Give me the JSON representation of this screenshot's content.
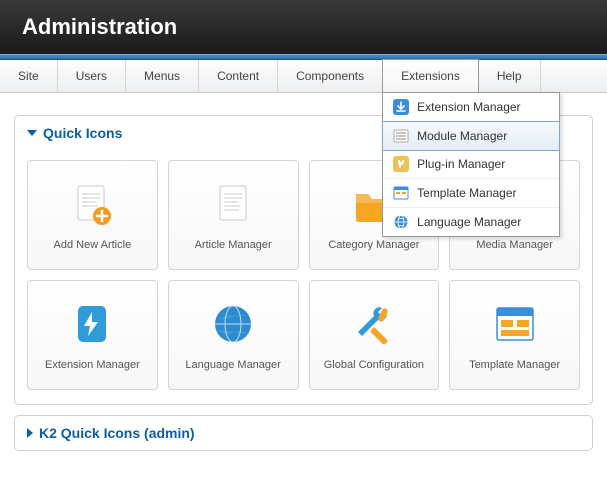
{
  "header": {
    "title": "Administration"
  },
  "menubar": {
    "items": [
      {
        "label": "Site"
      },
      {
        "label": "Users"
      },
      {
        "label": "Menus"
      },
      {
        "label": "Content"
      },
      {
        "label": "Components"
      },
      {
        "label": "Extensions",
        "open": true
      },
      {
        "label": "Help"
      }
    ]
  },
  "dropdown": {
    "items": [
      {
        "label": "Extension Manager",
        "icon": "download-icon"
      },
      {
        "label": "Module Manager",
        "icon": "list-icon",
        "highlighted": true
      },
      {
        "label": "Plug-in Manager",
        "icon": "plug-icon"
      },
      {
        "label": "Template Manager",
        "icon": "template-icon"
      },
      {
        "label": "Language Manager",
        "icon": "globe-icon"
      }
    ]
  },
  "panels": {
    "quick_icons": {
      "title": "Quick Icons",
      "open": true,
      "tiles": [
        {
          "label": "Add New Article",
          "icon": "article-add"
        },
        {
          "label": "Article Manager",
          "icon": "article"
        },
        {
          "label": "Category Manager",
          "icon": "folder"
        },
        {
          "label": "Media Manager",
          "icon": "media"
        },
        {
          "label": "Extension Manager",
          "icon": "extension"
        },
        {
          "label": "Language Manager",
          "icon": "globe"
        },
        {
          "label": "Global Configuration",
          "icon": "tools"
        },
        {
          "label": "Template Manager",
          "icon": "template"
        }
      ]
    },
    "k2": {
      "title": "K2 Quick Icons (admin)",
      "open": false
    }
  }
}
